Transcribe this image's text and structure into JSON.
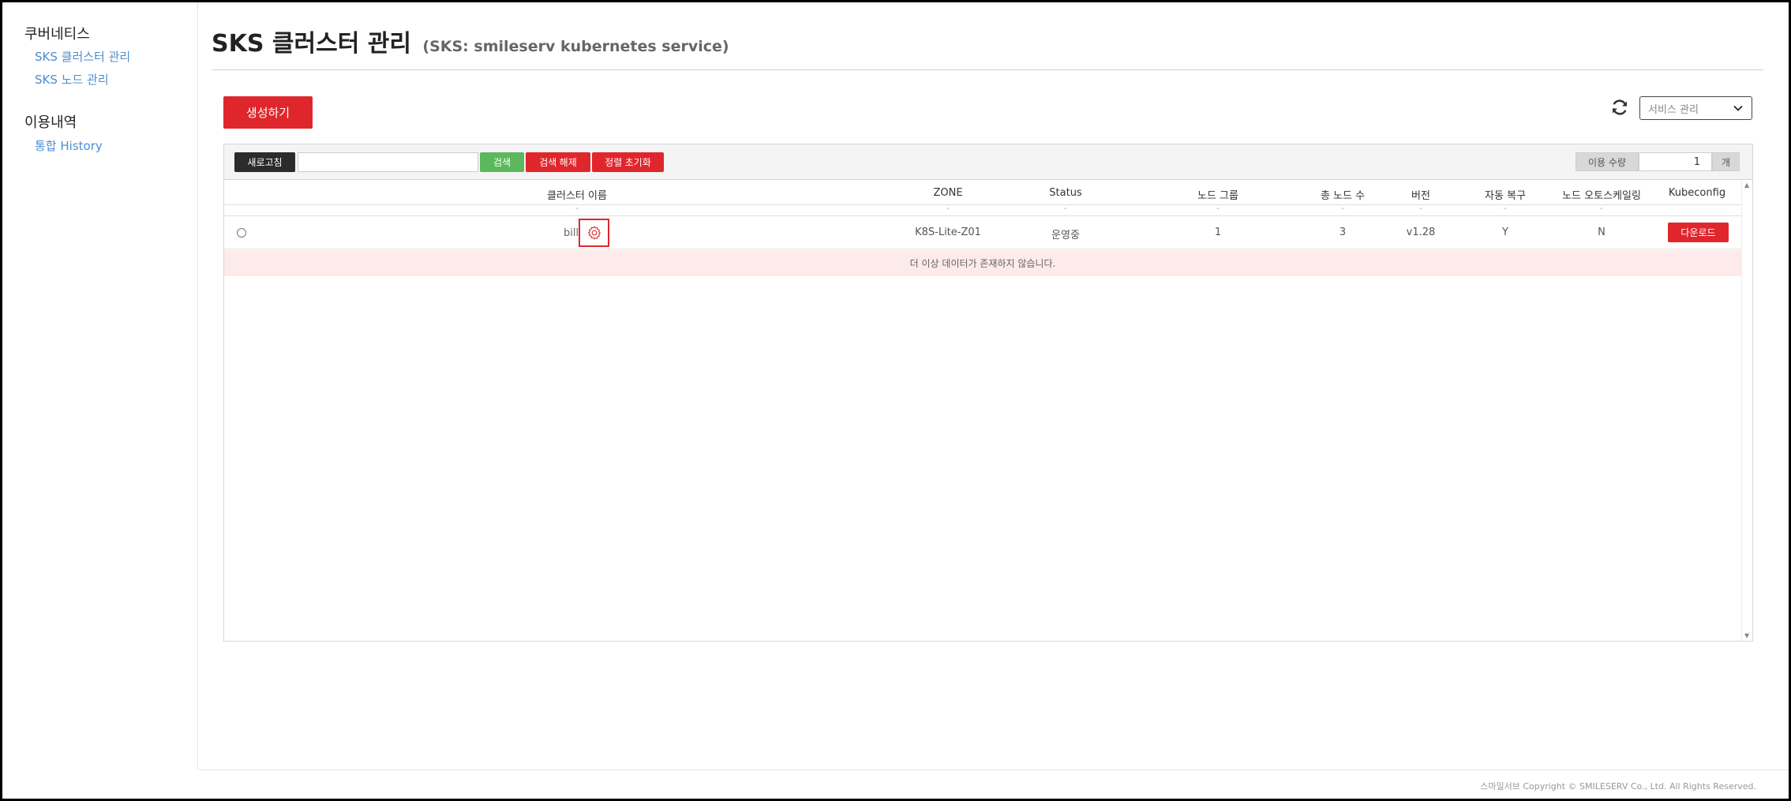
{
  "sidebar": {
    "groups": [
      {
        "title": "쿠버네티스",
        "items": [
          {
            "label": "SKS 클러스터 관리"
          },
          {
            "label": "SKS 노드 관리"
          }
        ]
      },
      {
        "title": "이용내역",
        "items": [
          {
            "label": "통합 History"
          }
        ]
      }
    ]
  },
  "header": {
    "title": "SKS 클러스터 관리",
    "subtitle": "(SKS: smileserv kubernetes service)"
  },
  "actions": {
    "create_label": "생성하기",
    "service_select": {
      "selected": "서비스 관리",
      "icon": "chevron-down-icon"
    },
    "refresh_icon": "refresh-icon"
  },
  "toolbar": {
    "refresh_label": "새로고침",
    "search_value": "",
    "search_label": "검색",
    "clear_label": "검색 해제",
    "sort_reset_label": "정렬 초기화",
    "usage_label": "이용 수량",
    "usage_value": "1",
    "usage_unit": "개"
  },
  "table": {
    "columns": [
      "클러스터 이름",
      "ZONE",
      "Status",
      "노드 그룹",
      "총 노드 수",
      "버전",
      "자동 복구",
      "노드 오토스케일링",
      "Kubeconfig"
    ],
    "filter_placeholder": "-",
    "rows": [
      {
        "name": "bill",
        "zone": "K8S-Lite-Z01",
        "status": "운영중",
        "node_groups": "1",
        "total_nodes": "3",
        "version": "v1.28",
        "auto_repair": "Y",
        "node_autoscaling": "N",
        "kubeconfig_label": "다운로드"
      }
    ],
    "no_more_data": "더 이상 데이터가 존재하지 않습니다."
  },
  "footer": {
    "copyright": "스마일서브 Copyright © SMILESERV Co., Ltd. All Rights Reserved."
  },
  "colors": {
    "accent_red": "#e0262d",
    "search_green": "#5cb85c",
    "link_blue": "#4a8fd4",
    "nodata_bg": "#fdeaea"
  }
}
